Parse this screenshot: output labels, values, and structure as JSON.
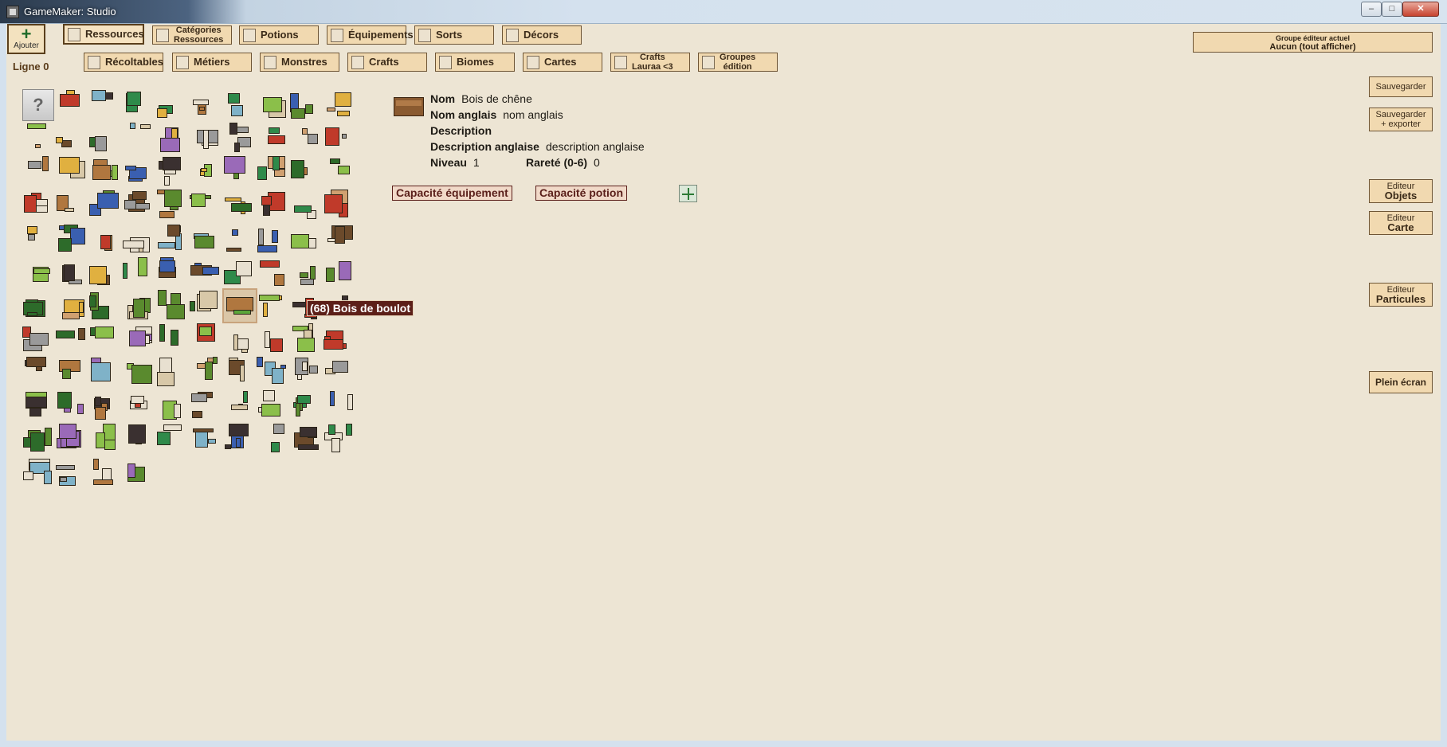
{
  "window": {
    "title": "GameMaker: Studio",
    "min": "–",
    "max": "□",
    "close": "✕"
  },
  "toolbar": {
    "add_label": "Ajouter",
    "row1": [
      {
        "label": "Ressources",
        "active": true
      },
      {
        "label": "Catégories\nRessources"
      },
      {
        "label": "Potions"
      },
      {
        "label": "Équipements"
      },
      {
        "label": "Sorts"
      },
      {
        "label": "Décors"
      }
    ],
    "row2": [
      {
        "label": "Récoltables"
      },
      {
        "label": "Métiers"
      },
      {
        "label": "Monstres"
      },
      {
        "label": "Crafts"
      },
      {
        "label": "Biomes"
      },
      {
        "label": "Cartes"
      },
      {
        "label": "Crafts\nLauraa <3"
      },
      {
        "label": "Groupes\nédition"
      }
    ],
    "line_label": "Ligne 0"
  },
  "editor_group": {
    "title": "Groupe éditeur actuel",
    "value": "Aucun (tout afficher)"
  },
  "right_buttons": {
    "save": "Sauvegarder",
    "save_export_1": "Sauvegarder",
    "save_export_2": "+ exporter",
    "objets_1": "Editeur",
    "objets_2": "Objets",
    "carte_1": "Editeur",
    "carte_2": "Carte",
    "particules_1": "Editeur",
    "particules_2": "Particules",
    "fullscreen": "Plein écran"
  },
  "grid": {
    "unknown_symbol": "?",
    "tooltip": "(68) Bois de boulot"
  },
  "details": {
    "name_key": "Nom",
    "name_value": "Bois de chêne",
    "en_name_key": "Nom anglais",
    "en_name_value": "nom anglais",
    "desc_key": "Description",
    "desc_value": "",
    "en_desc_key": "Description anglaise",
    "en_desc_value": "description anglaise",
    "level_key": "Niveau",
    "level_value": "1",
    "rarity_key": "Rareté (0-6)",
    "rarity_value": "0",
    "cap_equip": "Capacité équipement",
    "cap_potion": "Capacité potion"
  },
  "colors": {
    "background": "#ede5d4",
    "button": "#f1d9b0",
    "border": "#6e5535",
    "tooltip_bg": "#5c1f18",
    "capacity_text": "#5a1f1a"
  }
}
